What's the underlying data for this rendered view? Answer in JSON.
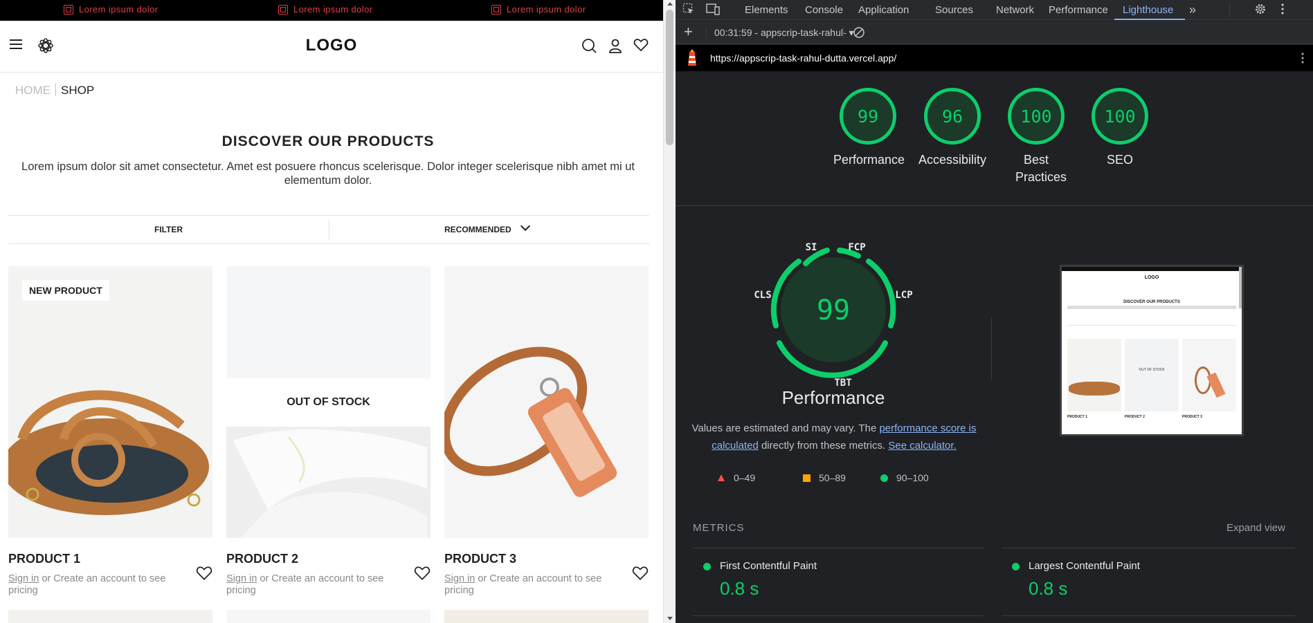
{
  "shop": {
    "promo": [
      "Lorem ipsum dolor",
      "Lorem ipsum dolor",
      "Lorem ipsum dolor"
    ],
    "logo": "LOGO",
    "breadcrumb": {
      "home": "HOME",
      "current": "SHOP"
    },
    "heading": "DISCOVER OUR PRODUCTS",
    "intro": "Lorem ipsum dolor sit amet consectetur. Amet est posuere rhoncus scelerisque. Dolor integer scelerisque nibh amet mi ut elementum dolor.",
    "filter_label": "FILTER",
    "sort_label": "RECOMMENDED",
    "products": [
      {
        "name": "PRODUCT 1",
        "badge": "NEW PRODUCT",
        "sign_in": "Sign in",
        "rest": " or Create an account to see pricing"
      },
      {
        "name": "PRODUCT 2",
        "badge": "OUT OF STOCK",
        "sign_in": "Sign in",
        "rest": " or Create an account to see pricing"
      },
      {
        "name": "PRODUCT 3",
        "badge": "",
        "sign_in": "Sign in",
        "rest": " or Create an account to see pricing"
      }
    ]
  },
  "devtools": {
    "tabs": [
      "Elements",
      "Console",
      "Application",
      "Sources",
      "Network",
      "Performance",
      "Lighthouse"
    ],
    "active_tab": "Lighthouse",
    "report_selector": "00:31:59 - appscrip-task-rahul-",
    "url": "https://appscrip-task-rahul-dutta.vercel.app/",
    "scores": [
      {
        "value": "99",
        "label": "Performance"
      },
      {
        "value": "96",
        "label": "Accessibility"
      },
      {
        "value": "100",
        "label": "Best Practices"
      },
      {
        "value": "100",
        "label": "SEO"
      }
    ],
    "perf_gauge": {
      "value": "99",
      "title": "Performance",
      "segments": {
        "si": "SI",
        "fcp": "FCP",
        "cls": "CLS",
        "lcp": "LCP",
        "tbt": "TBT"
      }
    },
    "note_prefix": "Values are estimated and may vary. The ",
    "note_link1": "performance score is calculated",
    "note_mid": " directly from these metrics. ",
    "note_link2": "See calculator.",
    "legend": [
      {
        "range": "0–49",
        "shape": "triangle",
        "color": "#ff4e42"
      },
      {
        "range": "50–89",
        "shape": "square",
        "color": "#ffa400"
      },
      {
        "range": "90–100",
        "shape": "circle",
        "color": "#0cce6b"
      }
    ],
    "metrics_header": "METRICS",
    "expand_view": "Expand view",
    "metrics": [
      {
        "name": "First Contentful Paint",
        "value": "0.8 s"
      },
      {
        "name": "Largest Contentful Paint",
        "value": "0.8 s"
      }
    ],
    "thumbnail": {
      "logo": "LOGO",
      "heading": "DISCOVER OUR PRODUCTS",
      "out_of_stock": "OUT OF STOCK",
      "products": [
        "PRODUCT 1",
        "PRODUCT 2",
        "PRODUCT 3"
      ]
    },
    "colors": {
      "pass": "#0cce6b",
      "average": "#ffa400",
      "fail": "#ff4e42",
      "accent": "#8ab4f8"
    }
  }
}
